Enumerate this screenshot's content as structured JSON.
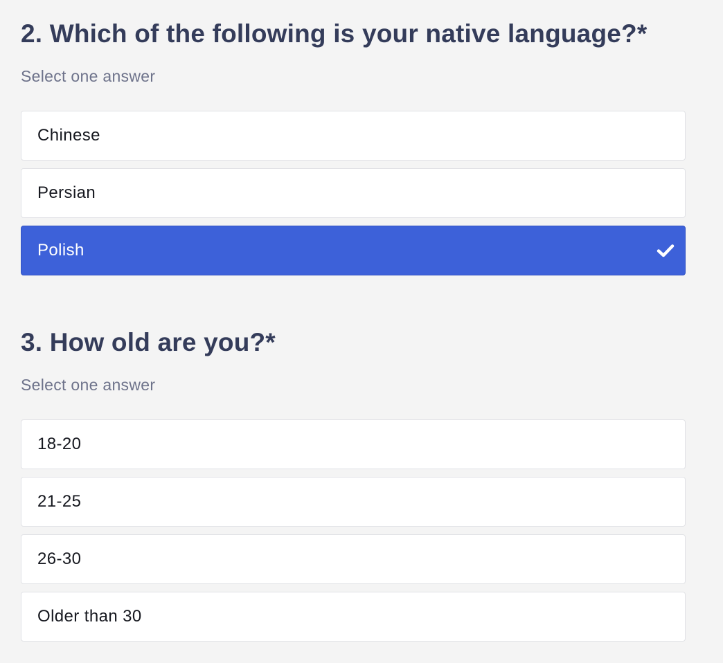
{
  "questions": [
    {
      "title": "2. Which of the following is your native language?*",
      "subtitle": "Select one answer",
      "options": [
        {
          "label": "Chinese",
          "selected": false
        },
        {
          "label": "Persian",
          "selected": false
        },
        {
          "label": "Polish",
          "selected": true
        }
      ]
    },
    {
      "title": "3. How old are you?*",
      "subtitle": "Select one answer",
      "options": [
        {
          "label": "18-20",
          "selected": false
        },
        {
          "label": "21-25",
          "selected": false
        },
        {
          "label": "26-30",
          "selected": false
        },
        {
          "label": "Older than 30",
          "selected": false
        }
      ]
    }
  ],
  "colors": {
    "selected_bg": "#3d61d9",
    "title_text": "#343c5a",
    "subtitle_text": "#6d728a"
  },
  "icons": {
    "selected_option": "check-icon"
  }
}
